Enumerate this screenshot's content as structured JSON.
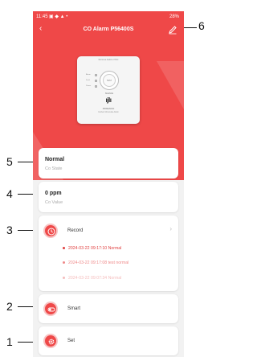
{
  "status_bar": {
    "time": "11:45",
    "icons": "▣ ◆ ▲ •",
    "battery": "28%"
  },
  "header": {
    "title": "CO Alarm P56400S"
  },
  "device": {
    "label": "Remove before if first",
    "test_button": "TEST SILENCE",
    "led_labels": [
      "Alarm",
      "Fault",
      "Power"
    ],
    "brand": "PRIMESIGN",
    "model": "Carbon Monoxide Alarm"
  },
  "cards": {
    "state": {
      "value": "Normal",
      "label": "Co State"
    },
    "co_value": {
      "value": "0 ppm",
      "label": "Co Value"
    },
    "record": {
      "label": "Record",
      "entries": [
        "2024-03-22 09:17:10 Normal",
        "2024-03-22 09:17:08 test normal",
        "2024-03-22 09:07:34 Normal"
      ]
    },
    "smart": {
      "label": "Smart"
    },
    "set": {
      "label": "Set"
    }
  },
  "callouts": [
    "1",
    "2",
    "3",
    "4",
    "5",
    "6"
  ],
  "colors": {
    "accent": "#ef4848",
    "record_entry_1": "#e04040",
    "record_entry_2": "#ef8a8a",
    "record_entry_3": "#f5bcbc"
  }
}
